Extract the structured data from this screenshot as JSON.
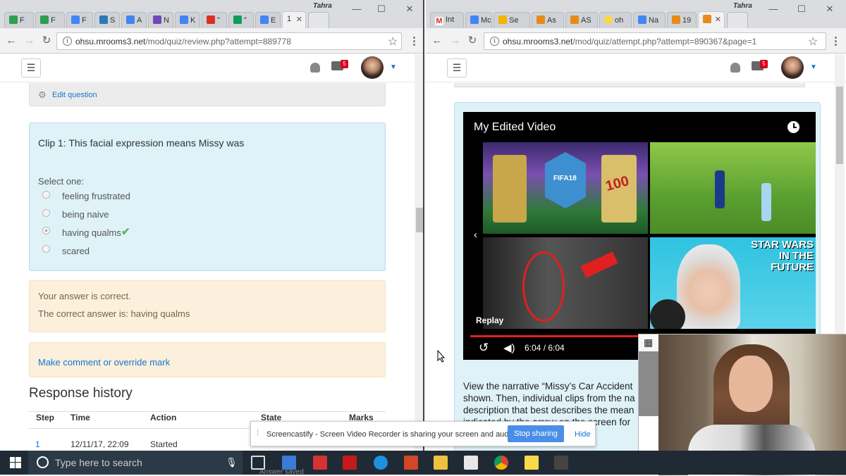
{
  "left": {
    "user": "Tahra",
    "tabs": [
      "F",
      "F",
      "F",
      "S",
      "A",
      "N",
      "K",
      "\"",
      "\"",
      "E",
      "1"
    ],
    "url_host": "ohsu.mrooms3.net",
    "url_path": "/mod/quiz/review.php?attempt=889778",
    "notif_count": "5",
    "edit_question": "Edit question",
    "question_text": "Clip 1: This facial expression means Missy was",
    "select_one": "Select one:",
    "options": [
      "feeling frustrated",
      "being naive",
      "having qualms",
      "scared"
    ],
    "feedback_1": "Your answer is correct.",
    "feedback_2": "The correct answer is: having qualms",
    "comment_link": "Make comment or override mark",
    "history_title": "Response history",
    "history_cols": [
      "Step",
      "Time",
      "Action",
      "State",
      "Marks"
    ],
    "history_row": [
      "1",
      "12/11/17, 22:09",
      "Started"
    ]
  },
  "right": {
    "user": "Tahra",
    "tabs": [
      "Int",
      "Mc",
      "Se",
      "As",
      "AS",
      "oh",
      "Na",
      "19",
      ""
    ],
    "url_host": "ohsu.mrooms3.net",
    "url_path": "/mod/quiz/attempt.php?attempt=890367&page=1",
    "notif_count": "5",
    "video_title": "My Edited Video",
    "thumb_card_label": "FIFA18",
    "thumb_card_num": "100",
    "thumb_sw": "STAR WARS IN THE FUTURE",
    "replay": "Replay",
    "time": "6:04 / 6:04",
    "narrative_1": "View the narrative “Missy’s Car Accident",
    "narrative_2": "shown. Then, individual clips from the na",
    "narrative_3": "description that best describes the mean",
    "narrative_4": "indicated by the arrow on the screen for"
  },
  "toast": {
    "text": "Screencastify - Screen Video Recorder is sharing your screen and audio.",
    "stop": "Stop sharing",
    "hide": "Hide"
  },
  "taskbar": {
    "search_placeholder": "Type here to search",
    "behind_text": "Answer saved"
  },
  "colors": {
    "question_bg": "#def2f8",
    "feedback_bg": "#fcefdc",
    "link": "#1177d1",
    "accent_button": "#4a8ee8",
    "taskbar": "#1f2a35"
  }
}
